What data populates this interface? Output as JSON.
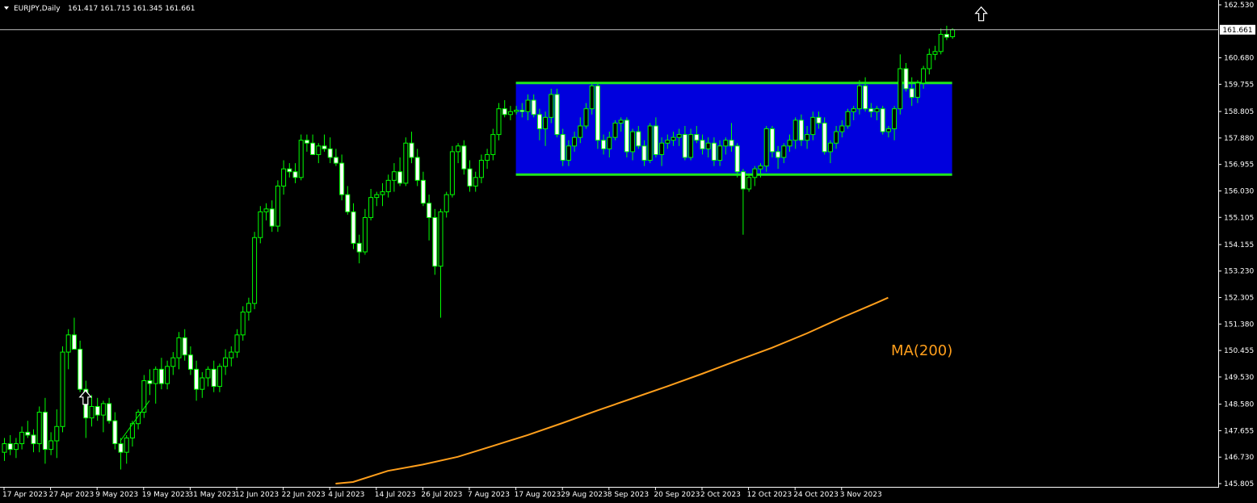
{
  "chart_data": {
    "type": "candlestick",
    "header": {
      "symbol_label": "EURJPY,Daily",
      "ohlc": "161.417 161.715 161.345 161.661"
    },
    "current_price_label": "161.661",
    "current_price": 161.661,
    "y_range": [
      145.805,
      162.53
    ],
    "y_ticks": [
      {
        "label": "162.530",
        "value": 162.53
      },
      {
        "label": "160.680",
        "value": 160.68
      },
      {
        "label": "159.755",
        "value": 159.755
      },
      {
        "label": "158.805",
        "value": 158.805
      },
      {
        "label": "157.880",
        "value": 157.88
      },
      {
        "label": "156.955",
        "value": 156.955
      },
      {
        "label": "156.030",
        "value": 156.03
      },
      {
        "label": "155.105",
        "value": 155.105
      },
      {
        "label": "154.155",
        "value": 154.155
      },
      {
        "label": "153.230",
        "value": 153.23
      },
      {
        "label": "152.305",
        "value": 152.305
      },
      {
        "label": "151.380",
        "value": 151.38
      },
      {
        "label": "150.455",
        "value": 150.455
      },
      {
        "label": "149.530",
        "value": 149.53
      },
      {
        "label": "148.580",
        "value": 148.58
      },
      {
        "label": "147.655",
        "value": 147.655
      },
      {
        "label": "146.730",
        "value": 146.73
      },
      {
        "label": "145.805",
        "value": 145.805
      }
    ],
    "x_ticks": [
      {
        "label": "17 Apr 2023",
        "index": 0
      },
      {
        "label": "27 Apr 2023",
        "index": 8
      },
      {
        "label": "9 May 2023",
        "index": 16
      },
      {
        "label": "19 May 2023",
        "index": 24
      },
      {
        "label": "31 May 2023",
        "index": 32
      },
      {
        "label": "12 Jun 2023",
        "index": 40
      },
      {
        "label": "22 Jun 2023",
        "index": 48
      },
      {
        "label": "4 Jul 2023",
        "index": 56
      },
      {
        "label": "14 Jul 2023",
        "index": 64
      },
      {
        "label": "26 Jul 2023",
        "index": 72
      },
      {
        "label": "7 Aug 2023",
        "index": 80
      },
      {
        "label": "17 Aug 2023",
        "index": 88
      },
      {
        "label": "29 Aug 2023",
        "index": 96
      },
      {
        "label": "8 Sep 2023",
        "index": 104
      },
      {
        "label": "20 Sep 2023",
        "index": 112
      },
      {
        "label": "2 Oct 2023",
        "index": 120
      },
      {
        "label": "12 Oct 2023",
        "index": 128
      },
      {
        "label": "24 Oct 2023",
        "index": 136
      },
      {
        "label": "3 Nov 2023",
        "index": 144
      }
    ],
    "candles": [
      [
        146.9,
        147.4,
        146.6,
        147.2
      ],
      [
        147.2,
        147.5,
        146.8,
        147.0
      ],
      [
        147.0,
        147.4,
        146.7,
        147.2
      ],
      [
        147.2,
        147.8,
        147.0,
        147.6
      ],
      [
        147.6,
        148.0,
        147.4,
        147.5
      ],
      [
        147.5,
        147.7,
        146.9,
        147.2
      ],
      [
        147.2,
        148.5,
        146.9,
        148.3
      ],
      [
        148.3,
        148.8,
        146.5,
        147.0
      ],
      [
        147.0,
        147.6,
        146.8,
        147.3
      ],
      [
        147.3,
        148.4,
        146.7,
        147.8
      ],
      [
        147.8,
        150.6,
        147.6,
        150.4
      ],
      [
        150.4,
        151.2,
        149.8,
        151.0
      ],
      [
        151.0,
        151.6,
        150.6,
        150.5
      ],
      [
        150.5,
        150.8,
        149.0,
        149.1
      ],
      [
        149.1,
        149.4,
        147.4,
        148.1
      ],
      [
        148.1,
        148.9,
        147.8,
        148.5
      ],
      [
        148.5,
        148.8,
        148.0,
        148.2
      ],
      [
        148.2,
        148.7,
        147.6,
        148.6
      ],
      [
        148.6,
        148.8,
        147.9,
        148.0
      ],
      [
        148.0,
        148.3,
        147.0,
        147.2
      ],
      [
        147.2,
        147.4,
        146.3,
        146.9
      ],
      [
        146.9,
        147.5,
        146.5,
        147.4
      ],
      [
        147.4,
        148.0,
        147.1,
        147.9
      ],
      [
        147.9,
        148.4,
        147.7,
        148.3
      ],
      [
        148.3,
        149.6,
        148.1,
        149.4
      ],
      [
        149.4,
        149.8,
        148.9,
        149.3
      ],
      [
        149.3,
        149.9,
        148.6,
        149.8
      ],
      [
        149.8,
        150.2,
        149.1,
        149.3
      ],
      [
        149.3,
        150.1,
        149.1,
        149.9
      ],
      [
        149.9,
        150.4,
        149.6,
        150.2
      ],
      [
        150.2,
        151.1,
        149.8,
        150.9
      ],
      [
        150.9,
        151.2,
        150.1,
        150.3
      ],
      [
        150.3,
        150.6,
        149.6,
        149.8
      ],
      [
        149.8,
        150.1,
        148.7,
        149.1
      ],
      [
        149.1,
        149.7,
        148.8,
        149.5
      ],
      [
        149.5,
        149.9,
        149.2,
        149.8
      ],
      [
        149.8,
        150.1,
        149.0,
        149.2
      ],
      [
        149.2,
        150.0,
        149.0,
        149.9
      ],
      [
        149.9,
        150.5,
        149.6,
        150.2
      ],
      [
        150.2,
        150.6,
        149.9,
        150.4
      ],
      [
        150.4,
        151.2,
        150.2,
        151.0
      ],
      [
        151.0,
        152.0,
        150.8,
        151.8
      ],
      [
        151.8,
        152.3,
        151.5,
        152.1
      ],
      [
        152.1,
        154.6,
        151.9,
        154.4
      ],
      [
        154.4,
        155.5,
        154.2,
        155.3
      ],
      [
        155.3,
        155.6,
        155.0,
        155.4
      ],
      [
        155.4,
        155.7,
        154.6,
        154.8
      ],
      [
        154.8,
        156.4,
        154.6,
        156.2
      ],
      [
        156.2,
        157.1,
        155.9,
        156.8
      ],
      [
        156.8,
        157.0,
        156.5,
        156.7
      ],
      [
        156.7,
        157.0,
        156.3,
        156.5
      ],
      [
        156.5,
        158.0,
        156.4,
        157.8
      ],
      [
        157.8,
        158.0,
        157.4,
        157.7
      ],
      [
        157.7,
        158.0,
        157.3,
        157.3
      ],
      [
        157.3,
        157.7,
        157.0,
        157.6
      ],
      [
        157.6,
        158.0,
        157.4,
        157.5
      ],
      [
        157.5,
        157.9,
        157.0,
        157.2
      ],
      [
        157.2,
        157.5,
        156.9,
        157.0
      ],
      [
        157.0,
        157.3,
        155.7,
        155.9
      ],
      [
        155.9,
        156.2,
        155.2,
        155.3
      ],
      [
        155.3,
        155.6,
        154.0,
        154.2
      ],
      [
        154.2,
        154.5,
        153.5,
        153.9
      ],
      [
        153.9,
        155.4,
        153.8,
        155.1
      ],
      [
        155.1,
        156.1,
        155.0,
        155.8
      ],
      [
        155.8,
        156.0,
        155.5,
        155.9
      ],
      [
        155.9,
        156.3,
        155.5,
        156.0
      ],
      [
        156.0,
        156.6,
        155.8,
        156.4
      ],
      [
        156.4,
        157.0,
        156.0,
        156.7
      ],
      [
        156.7,
        157.2,
        156.2,
        156.3
      ],
      [
        156.3,
        157.9,
        156.2,
        157.7
      ],
      [
        157.7,
        158.1,
        157.0,
        157.2
      ],
      [
        157.2,
        157.5,
        156.2,
        156.4
      ],
      [
        156.4,
        156.7,
        155.5,
        155.6
      ],
      [
        155.6,
        155.9,
        154.3,
        155.1
      ],
      [
        155.1,
        155.4,
        153.1,
        153.4
      ],
      [
        153.4,
        155.4,
        151.6,
        155.3
      ],
      [
        155.3,
        156.0,
        155.1,
        155.9
      ],
      [
        155.9,
        157.6,
        155.8,
        157.4
      ],
      [
        157.4,
        157.7,
        157.0,
        157.6
      ],
      [
        157.6,
        157.8,
        156.6,
        156.8
      ],
      [
        156.8,
        157.1,
        156.0,
        156.2
      ],
      [
        156.2,
        156.7,
        156.0,
        156.5
      ],
      [
        156.5,
        157.3,
        156.3,
        157.1
      ],
      [
        157.1,
        157.5,
        156.8,
        157.3
      ],
      [
        157.3,
        158.2,
        157.1,
        158.0
      ],
      [
        158.0,
        159.1,
        157.8,
        158.9
      ],
      [
        158.9,
        159.2,
        158.6,
        158.7
      ],
      [
        158.7,
        159.0,
        158.5,
        158.8
      ],
      [
        158.8,
        159.0,
        158.7,
        158.85
      ],
      [
        158.85,
        159.1,
        158.6,
        158.8
      ],
      [
        158.8,
        159.4,
        158.5,
        159.2
      ],
      [
        159.2,
        159.4,
        158.6,
        158.7
      ],
      [
        158.7,
        158.9,
        157.8,
        158.2
      ],
      [
        158.2,
        158.8,
        157.6,
        158.6
      ],
      [
        158.6,
        159.6,
        158.4,
        159.4
      ],
      [
        159.4,
        159.6,
        157.9,
        158.0
      ],
      [
        158.0,
        158.2,
        156.9,
        157.1
      ],
      [
        157.1,
        157.8,
        156.9,
        157.6
      ],
      [
        157.6,
        158.1,
        157.4,
        157.9
      ],
      [
        157.9,
        158.6,
        157.7,
        158.3
      ],
      [
        158.3,
        159.1,
        158.2,
        158.9
      ],
      [
        158.9,
        159.8,
        158.7,
        159.7
      ],
      [
        159.7,
        159.8,
        157.5,
        157.8
      ],
      [
        157.8,
        158.0,
        157.3,
        157.5
      ],
      [
        157.5,
        158.1,
        157.2,
        157.9
      ],
      [
        157.9,
        158.5,
        157.8,
        158.4
      ],
      [
        158.4,
        158.6,
        158.1,
        158.5
      ],
      [
        158.5,
        158.6,
        157.2,
        157.4
      ],
      [
        157.4,
        158.2,
        157.1,
        158.1
      ],
      [
        158.1,
        158.3,
        157.5,
        157.6
      ],
      [
        157.6,
        157.8,
        156.9,
        157.1
      ],
      [
        157.1,
        158.4,
        157.0,
        158.3
      ],
      [
        158.3,
        158.6,
        157.2,
        157.3
      ],
      [
        157.3,
        157.9,
        156.9,
        157.7
      ],
      [
        157.7,
        158.0,
        157.5,
        157.8
      ],
      [
        157.8,
        158.1,
        157.6,
        157.9
      ],
      [
        157.9,
        158.2,
        157.6,
        158.0
      ],
      [
        158.0,
        158.3,
        157.1,
        157.2
      ],
      [
        157.2,
        158.2,
        157.1,
        158.0
      ],
      [
        158.0,
        158.3,
        157.7,
        157.8
      ],
      [
        157.8,
        158.0,
        157.3,
        157.5
      ],
      [
        157.5,
        157.9,
        157.2,
        157.7
      ],
      [
        157.7,
        157.9,
        156.9,
        157.1
      ],
      [
        157.1,
        157.8,
        156.9,
        157.6
      ],
      [
        157.6,
        157.9,
        157.3,
        157.8
      ],
      [
        157.8,
        158.4,
        157.4,
        157.6
      ],
      [
        157.6,
        157.7,
        156.5,
        156.7
      ],
      [
        156.7,
        156.8,
        154.5,
        156.1
      ],
      [
        156.1,
        156.6,
        156.0,
        156.5
      ],
      [
        156.5,
        156.9,
        156.2,
        156.8
      ],
      [
        156.8,
        157.0,
        156.5,
        156.9
      ],
      [
        156.9,
        158.3,
        156.7,
        158.2
      ],
      [
        158.2,
        158.3,
        157.2,
        157.4
      ],
      [
        157.4,
        157.6,
        156.8,
        157.2
      ],
      [
        157.2,
        157.7,
        157.0,
        157.6
      ],
      [
        157.6,
        158.0,
        157.4,
        157.8
      ],
      [
        157.8,
        158.6,
        157.5,
        158.5
      ],
      [
        158.5,
        158.7,
        157.6,
        157.8
      ],
      [
        157.8,
        158.3,
        157.5,
        158.0
      ],
      [
        158.0,
        158.8,
        157.8,
        158.6
      ],
      [
        158.6,
        158.8,
        158.2,
        158.4
      ],
      [
        158.4,
        158.6,
        157.3,
        157.4
      ],
      [
        157.4,
        157.8,
        157.0,
        157.7
      ],
      [
        157.7,
        158.3,
        157.5,
        158.1
      ],
      [
        158.1,
        158.5,
        157.9,
        158.3
      ],
      [
        158.3,
        158.9,
        158.2,
        158.8
      ],
      [
        158.8,
        159.0,
        158.5,
        158.9
      ],
      [
        158.9,
        159.9,
        158.7,
        159.7
      ],
      [
        159.7,
        160.0,
        158.8,
        158.9
      ],
      [
        158.9,
        159.1,
        158.6,
        158.8
      ],
      [
        158.8,
        159.0,
        158.5,
        158.9
      ],
      [
        158.9,
        159.0,
        158.0,
        158.1
      ],
      [
        158.1,
        158.3,
        157.9,
        158.2
      ],
      [
        158.2,
        159.0,
        157.8,
        158.9
      ],
      [
        158.9,
        160.8,
        158.7,
        160.3
      ],
      [
        160.3,
        160.5,
        159.5,
        159.6
      ],
      [
        159.6,
        160.0,
        159.0,
        159.3
      ],
      [
        159.3,
        159.9,
        159.1,
        159.8
      ],
      [
        159.8,
        160.4,
        159.6,
        160.3
      ],
      [
        160.3,
        161.0,
        160.1,
        160.8
      ],
      [
        160.8,
        161.1,
        160.6,
        160.9
      ],
      [
        160.9,
        161.7,
        160.8,
        161.5
      ],
      [
        161.5,
        161.8,
        161.3,
        161.4
      ],
      [
        161.417,
        161.715,
        161.345,
        161.661
      ]
    ],
    "rectangle": {
      "start_index": 88,
      "end_index": 163,
      "top": 159.8,
      "bottom": 156.6
    },
    "arrows": [
      {
        "index": 14,
        "price": 148.8
      },
      {
        "index": 168,
        "price": 162.2
      }
    ],
    "support_line": {
      "from_index": 20,
      "from_price": 147.3,
      "to_index": 25,
      "to_price": 148.7
    },
    "ma": {
      "label": "MA(200)",
      "period": 200,
      "points": [
        {
          "i": 57,
          "v": 145.805
        },
        {
          "i": 60,
          "v": 145.86
        },
        {
          "i": 66,
          "v": 146.25
        },
        {
          "i": 72,
          "v": 146.47
        },
        {
          "i": 78,
          "v": 146.74
        },
        {
          "i": 84,
          "v": 147.12
        },
        {
          "i": 90,
          "v": 147.5
        },
        {
          "i": 96,
          "v": 147.92
        },
        {
          "i": 102,
          "v": 148.36
        },
        {
          "i": 108,
          "v": 148.78
        },
        {
          "i": 114,
          "v": 149.2
        },
        {
          "i": 120,
          "v": 149.64
        },
        {
          "i": 126,
          "v": 150.1
        },
        {
          "i": 132,
          "v": 150.55
        },
        {
          "i": 138,
          "v": 151.05
        },
        {
          "i": 144,
          "v": 151.6
        },
        {
          "i": 150,
          "v": 152.12
        },
        {
          "i": 152,
          "v": 152.3
        }
      ]
    },
    "colors": {
      "background": "#000000",
      "foreground": "#ffffff",
      "bull_body": "#000000",
      "bear_body": "#ffffff",
      "wick": "#00ff00",
      "rectangle_fill": "#0000dd",
      "rectangle_border": "#1ee61e",
      "ma_line": "#ff9f1c",
      "price_line": "#c0c0c0"
    }
  }
}
